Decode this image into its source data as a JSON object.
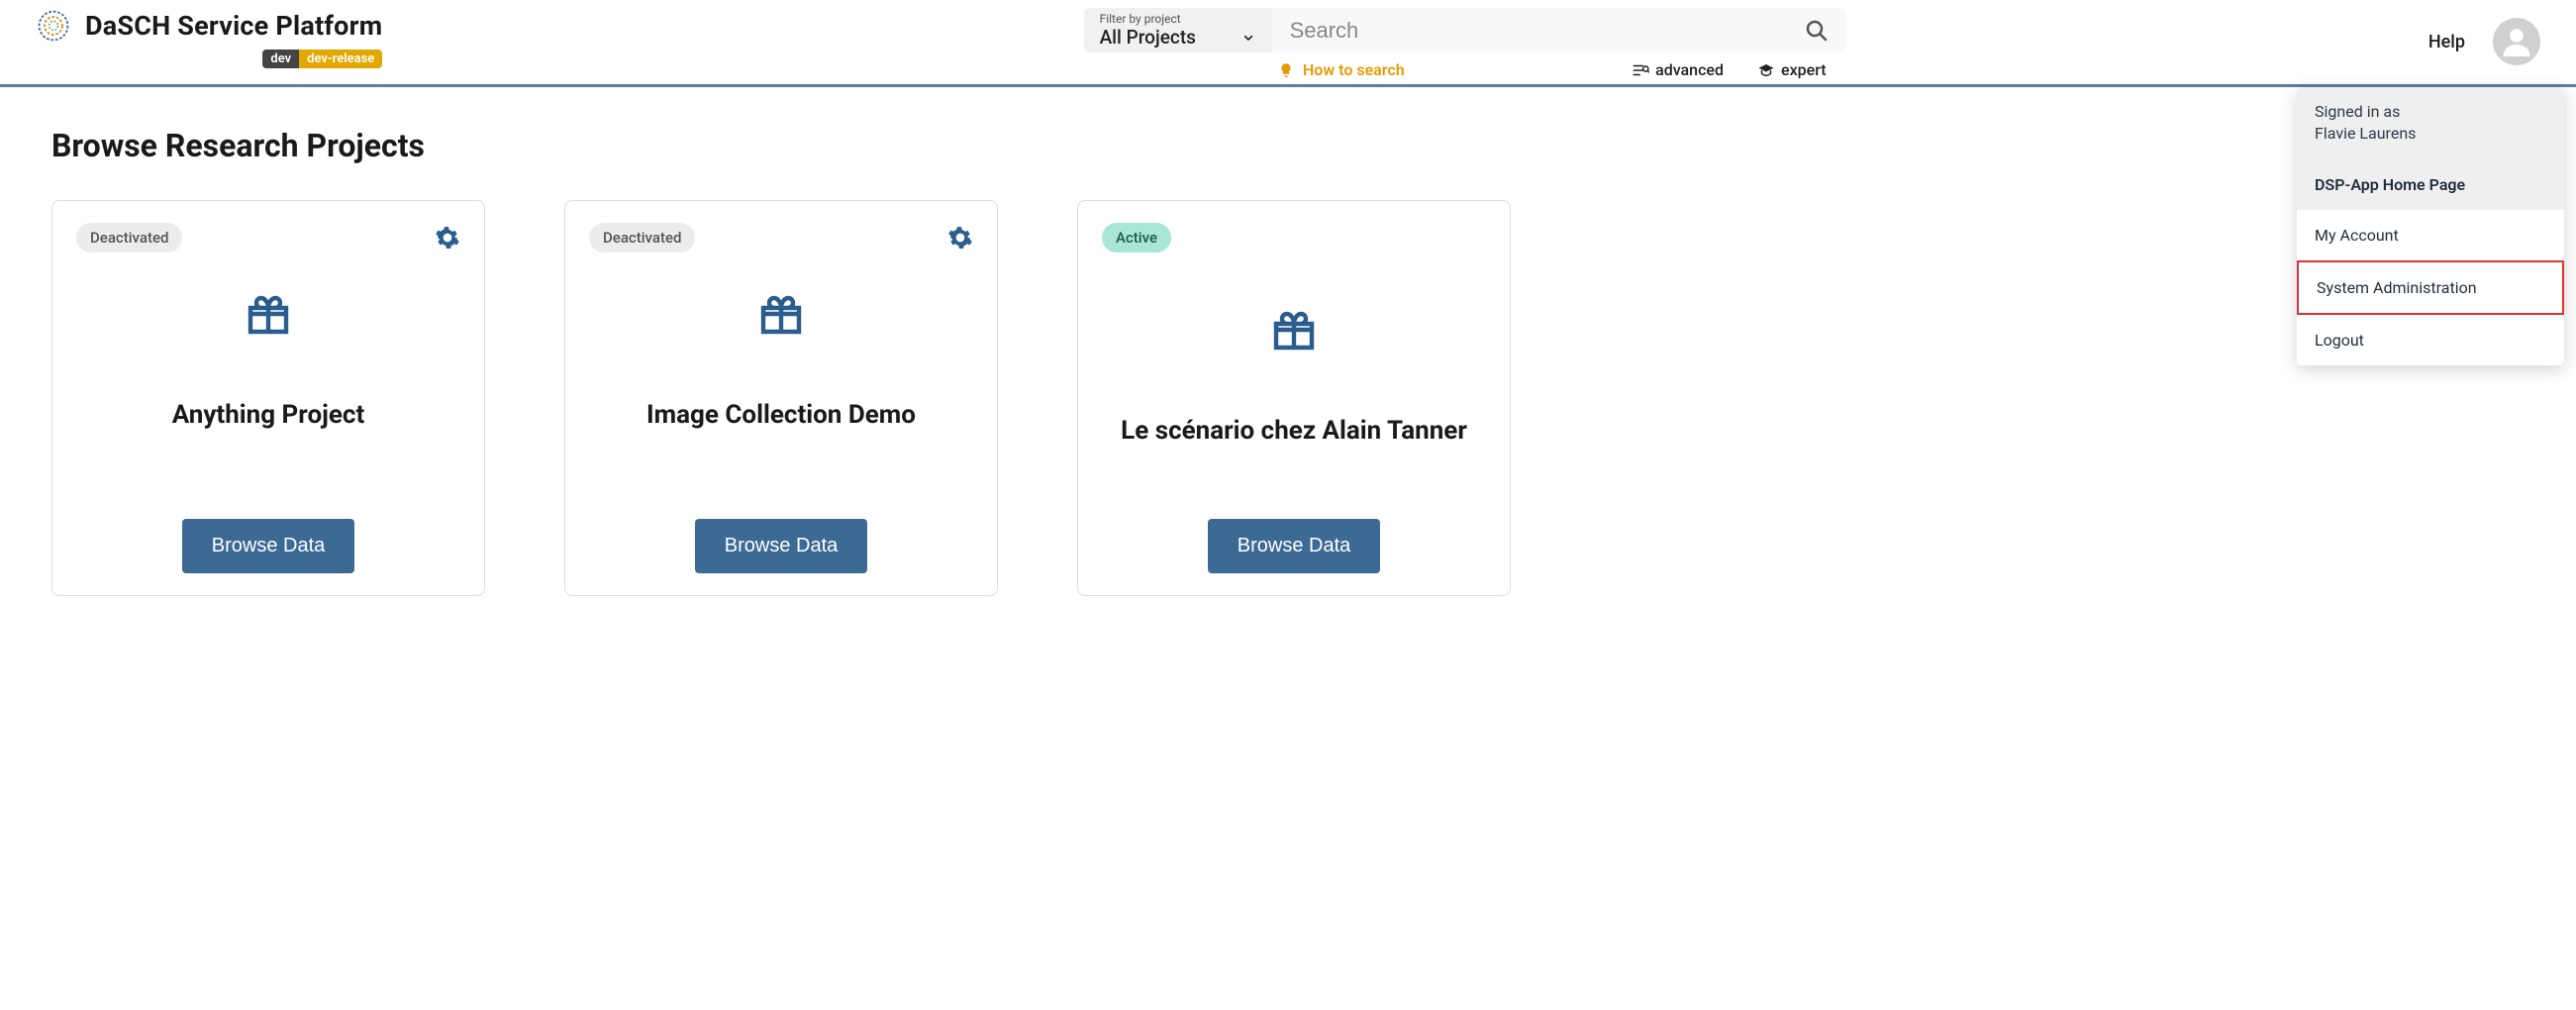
{
  "header": {
    "platform_title": "DaSCH Service Platform",
    "badge_dev": "dev",
    "badge_release": "dev-release",
    "filter_label": "Filter by project",
    "filter_value": "All Projects",
    "search_placeholder": "Search",
    "how_to_search": "How to search",
    "advanced": "advanced",
    "expert": "expert",
    "help": "Help"
  },
  "page": {
    "title": "Browse Research Projects"
  },
  "projects": [
    {
      "status": "Deactivated",
      "status_kind": "deact",
      "title": "Anything Project",
      "button": "Browse Data"
    },
    {
      "status": "Deactivated",
      "status_kind": "deact",
      "title": "Image Collection Demo",
      "button": "Browse Data"
    },
    {
      "status": "Active",
      "status_kind": "active",
      "title": "Le scénario chez Alain Tanner",
      "button": "Browse Data"
    }
  ],
  "user_menu": {
    "signed_in_prefix": "Signed in as",
    "user_name": "Flavie Laurens",
    "items": [
      {
        "label": "DSP-App Home Page",
        "highlight": true
      },
      {
        "label": "My Account"
      },
      {
        "label": "System Administration",
        "outlined": true
      },
      {
        "label": "Logout"
      }
    ]
  }
}
